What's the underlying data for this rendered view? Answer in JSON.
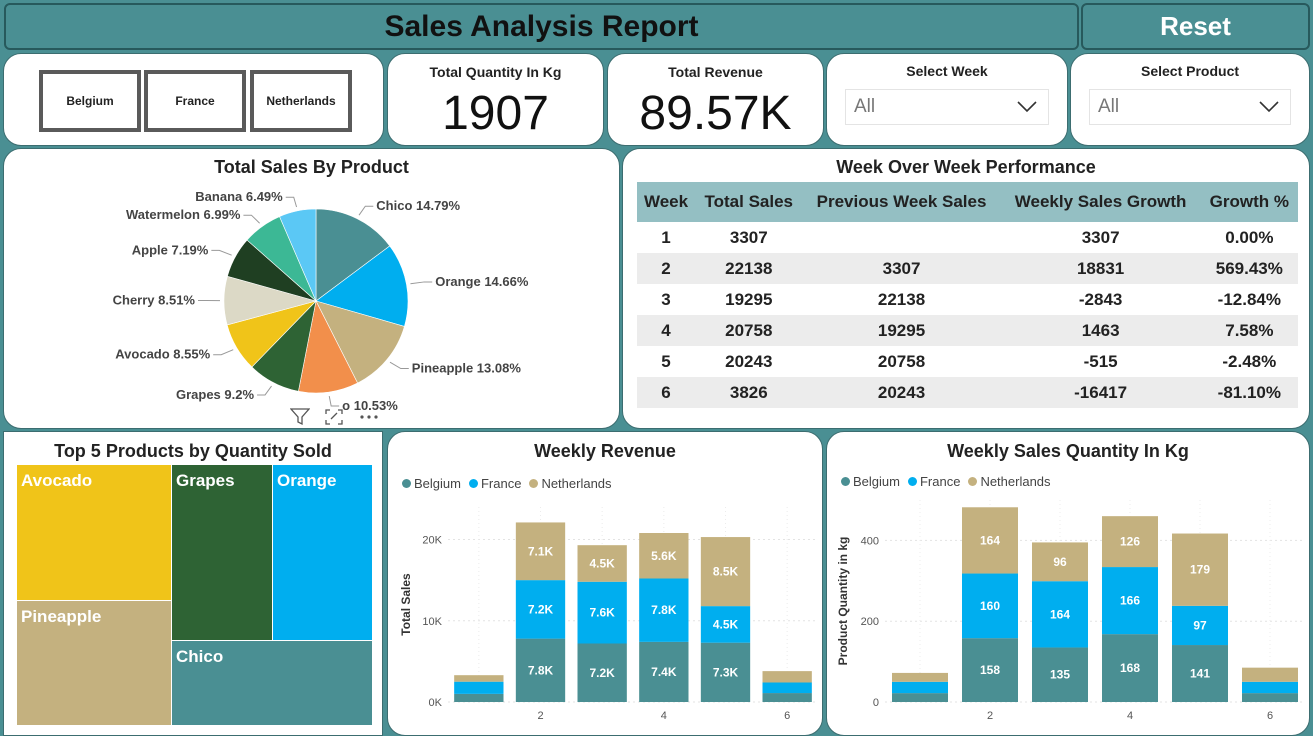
{
  "header": {
    "title": "Sales Analysis Report",
    "reset_label": "Reset"
  },
  "countries": [
    "Belgium",
    "France",
    "Netherlands"
  ],
  "kpis": {
    "quantity_label": "Total Quantity In Kg",
    "quantity_value": "1907",
    "revenue_label": "Total Revenue",
    "revenue_value": "89.57K"
  },
  "slicers": {
    "week_label": "Select Week",
    "week_value": "All",
    "product_label": "Select Product",
    "product_value": "All"
  },
  "colors": {
    "belgium": "#4a8f93",
    "france": "#00aeef",
    "netherlands": "#c4b17f",
    "bg": "#4a8f93"
  },
  "icons": [
    "filter-icon",
    "focus-mode-icon",
    "more-options-icon"
  ],
  "chart_data": [
    {
      "type": "pie",
      "title": "Total Sales By Product",
      "slices": [
        {
          "label": "Chico",
          "pct_label": "Chico 14.79%",
          "value": 14.79,
          "color": "#4a8f93"
        },
        {
          "label": "Orange",
          "pct_label": "Orange 14.66%",
          "value": 14.66,
          "color": "#00aeef"
        },
        {
          "label": "Pineapple",
          "pct_label": "Pineapple 13.08%",
          "value": 13.08,
          "color": "#c4b17f"
        },
        {
          "label": "Mango",
          "pct_label": "o 10.53%",
          "value": 10.53,
          "color": "#f28f4b"
        },
        {
          "label": "Grapes",
          "pct_label": "Grapes 9.2%",
          "value": 9.2,
          "color": "#2e6334"
        },
        {
          "label": "Avocado",
          "pct_label": "Avocado 8.55%",
          "value": 8.55,
          "color": "#f0c419"
        },
        {
          "label": "Cherry",
          "pct_label": "Cherry 8.51%",
          "value": 8.51,
          "color": "#dcd9c6"
        },
        {
          "label": "Apple",
          "pct_label": "Apple 7.19%",
          "value": 7.19,
          "color": "#1f3f22"
        },
        {
          "label": "Watermelon",
          "pct_label": "Watermelon 6.99%",
          "value": 6.99,
          "color": "#3cb895"
        },
        {
          "label": "Banana",
          "pct_label": "Banana 6.49%",
          "value": 6.49,
          "color": "#5bc8f5"
        }
      ]
    },
    {
      "type": "table",
      "title": "Week Over Week Performance",
      "columns": [
        "Week",
        "Total Sales",
        "Previous Week Sales",
        "Weekly Sales Growth",
        "Growth %"
      ],
      "rows": [
        [
          "1",
          "3307",
          "",
          "3307",
          "0.00%"
        ],
        [
          "2",
          "22138",
          "3307",
          "18831",
          "569.43%"
        ],
        [
          "3",
          "19295",
          "22138",
          "-2843",
          "-12.84%"
        ],
        [
          "4",
          "20758",
          "19295",
          "1463",
          "7.58%"
        ],
        [
          "5",
          "20243",
          "20758",
          "-515",
          "-2.48%"
        ],
        [
          "6",
          "3826",
          "20243",
          "-16417",
          "-81.10%"
        ]
      ]
    },
    {
      "type": "treemap",
      "title": "Top 5 Products by Quantity Sold",
      "items": [
        {
          "label": "Avocado",
          "color": "#f0c419"
        },
        {
          "label": "Grapes",
          "color": "#2e6334"
        },
        {
          "label": "Orange",
          "color": "#00aeef"
        },
        {
          "label": "Pineapple",
          "color": "#c4b17f"
        },
        {
          "label": "Chico",
          "color": "#4a8f93"
        }
      ]
    },
    {
      "type": "bar",
      "stacked": true,
      "title": "Weekly Revenue",
      "ylabel": "Total Sales",
      "ylim": [
        0,
        24000
      ],
      "yticks": [
        0,
        10000,
        20000
      ],
      "ytick_labels": [
        "0K",
        "10K",
        "20K"
      ],
      "x": [
        1,
        2,
        3,
        4,
        5,
        6
      ],
      "xtick_labels": [
        "2",
        "4",
        "6"
      ],
      "legend": [
        "Belgium",
        "France",
        "Netherlands"
      ],
      "series": [
        {
          "name": "Belgium",
          "values": [
            1000,
            7800,
            7200,
            7400,
            7300,
            1100
          ],
          "labels": [
            "",
            "7.8K",
            "7.2K",
            "7.4K",
            "7.3K",
            ""
          ]
        },
        {
          "name": "France",
          "values": [
            1500,
            7200,
            7600,
            7800,
            4500,
            1300
          ],
          "labels": [
            "",
            "7.2K",
            "7.6K",
            "7.8K",
            "4.5K",
            ""
          ]
        },
        {
          "name": "Netherlands",
          "values": [
            800,
            7100,
            4500,
            5600,
            8500,
            1400
          ],
          "labels": [
            "",
            "7.1K",
            "4.5K",
            "5.6K",
            "8.5K",
            ""
          ]
        }
      ]
    },
    {
      "type": "bar",
      "stacked": true,
      "title": "Weekly Sales Quantity In Kg",
      "ylabel": "Product Quantity in kg",
      "ylim": [
        0,
        500
      ],
      "yticks": [
        0,
        200,
        400
      ],
      "ytick_labels": [
        "0",
        "200",
        "400"
      ],
      "x": [
        1,
        2,
        3,
        4,
        5,
        6
      ],
      "xtick_labels": [
        "2",
        "4",
        "6"
      ],
      "legend": [
        "Belgium",
        "France",
        "Netherlands"
      ],
      "series": [
        {
          "name": "Belgium",
          "values": [
            22,
            158,
            135,
            168,
            141,
            22
          ],
          "labels": [
            "",
            "158",
            "135",
            "168",
            "141",
            ""
          ]
        },
        {
          "name": "France",
          "values": [
            28,
            160,
            164,
            166,
            97,
            28
          ],
          "labels": [
            "",
            "160",
            "164",
            "166",
            "97",
            ""
          ]
        },
        {
          "name": "Netherlands",
          "values": [
            22,
            164,
            96,
            126,
            179,
            35
          ],
          "labels": [
            "",
            "164",
            "96",
            "126",
            "179",
            ""
          ]
        }
      ]
    }
  ]
}
